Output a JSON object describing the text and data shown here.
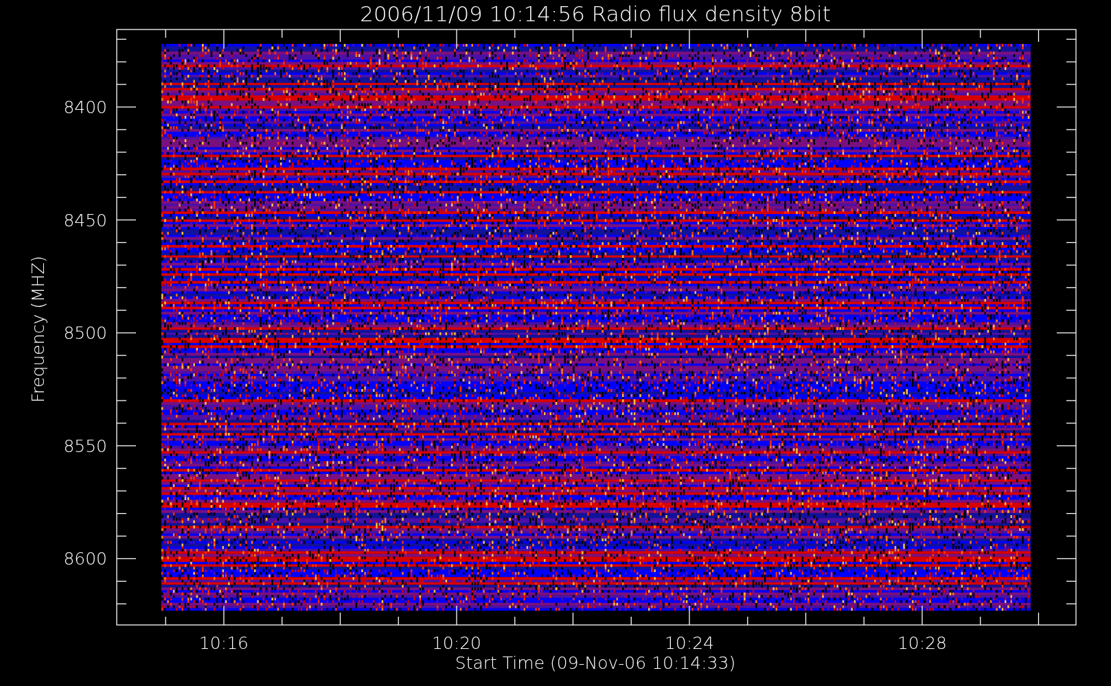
{
  "title": "2006/11/09 10:14:56 Radio flux density 8bit",
  "y_axis": {
    "label": "Frequency (MHZ)",
    "tick_labels": [
      "8400",
      "8450",
      "8500",
      "8550",
      "8600"
    ]
  },
  "x_axis": {
    "label": "Start Time (09-Nov-06 10:14:33)",
    "tick_labels": [
      "10:16",
      "10:20",
      "10:24",
      "10:28"
    ]
  }
}
